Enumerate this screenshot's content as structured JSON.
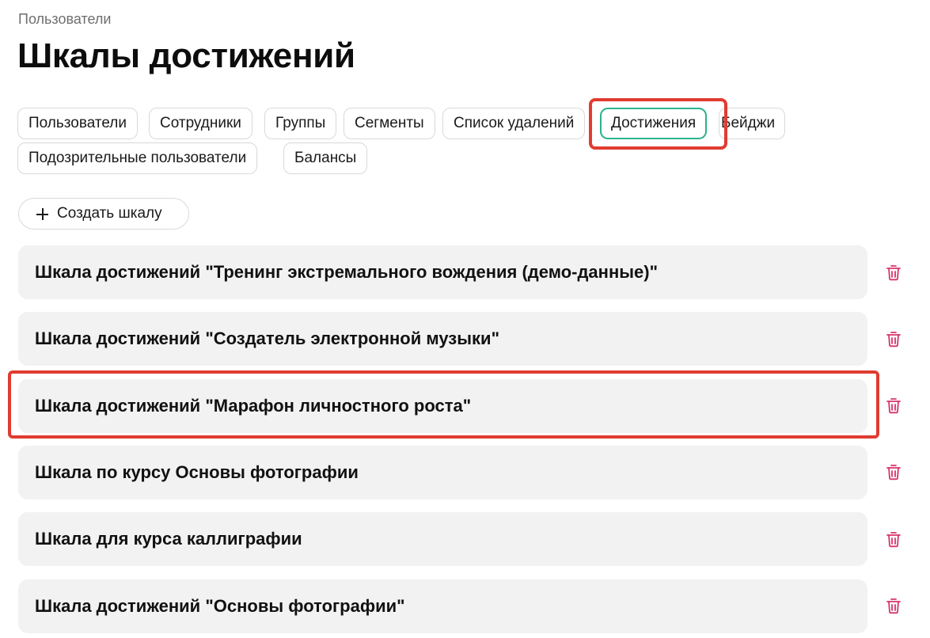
{
  "breadcrumb": "Пользователи",
  "title": "Шкалы достижений",
  "tabs": [
    {
      "label": "Пользователи"
    },
    {
      "label": "Сотрудники"
    },
    {
      "label": "Группы"
    },
    {
      "label": "Сегменты"
    },
    {
      "label": "Список удалений"
    },
    {
      "label": "Достижения",
      "active": true
    },
    {
      "label": "Бейджи"
    },
    {
      "label": "Подозрительные пользователи"
    },
    {
      "label": "Балансы"
    }
  ],
  "create_button": {
    "label": "Создать шкалу",
    "icon": "plus-icon"
  },
  "scales": [
    {
      "name": "Шкала достижений \"Тренинг экстремального вождения (демо-данные)\""
    },
    {
      "name": "Шкала достижений \"Создатель электронной музыки\""
    },
    {
      "name": "Шкала достижений \"Марафон личностного роста\"",
      "highlighted": true
    },
    {
      "name": "Шкала по курсу Основы фотографии"
    },
    {
      "name": "Шкала для курса каллиграфии"
    },
    {
      "name": "Шкала достижений \"Основы фотографии\""
    }
  ],
  "row_action_icon": "trash-icon",
  "colors": {
    "accent": "#2bb38c",
    "delete": "#d6336c",
    "highlight": "#e03c31",
    "row_background": "#f2f2f2"
  }
}
